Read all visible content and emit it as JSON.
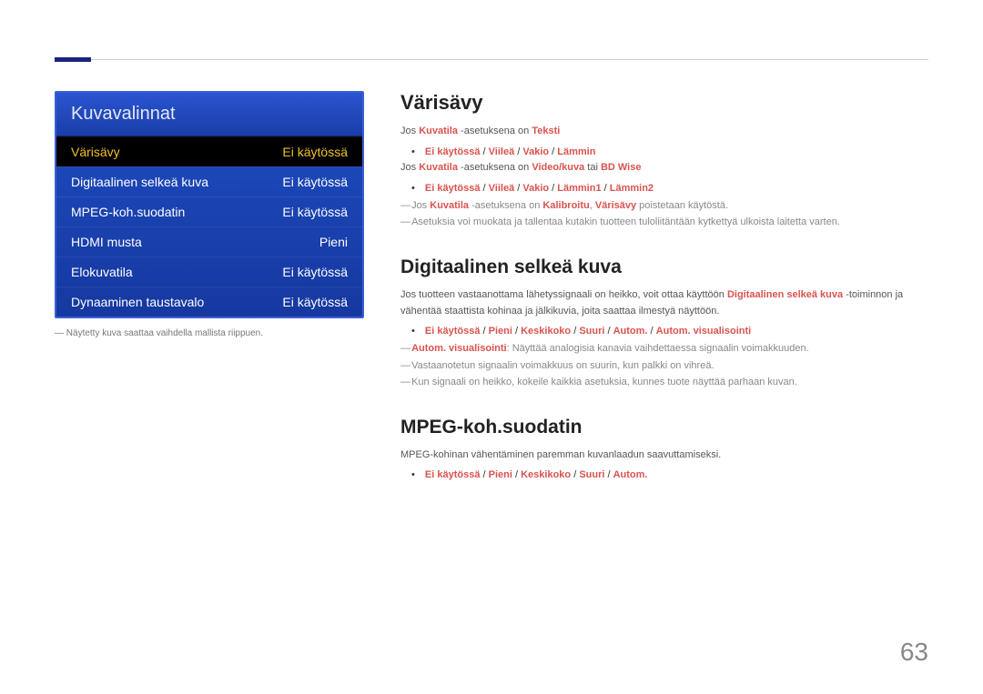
{
  "menu": {
    "title": "Kuvavalinnat",
    "rows": [
      {
        "label": "Värisävy",
        "value": "Ei käytössä",
        "highlight": true
      },
      {
        "label": "Digitaalinen selkeä kuva",
        "value": "Ei käytössä",
        "highlight": false
      },
      {
        "label": "MPEG-koh.suodatin",
        "value": "Ei käytössä",
        "highlight": false
      },
      {
        "label": "HDMI musta",
        "value": "Pieni",
        "highlight": false
      },
      {
        "label": "Elokuvatila",
        "value": "Ei käytössä",
        "highlight": false
      },
      {
        "label": "Dynaaminen taustavalo",
        "value": "Ei käytössä",
        "highlight": false
      }
    ],
    "caption_prefix": "―  ",
    "caption": "Näytetty kuva saattaa vaihdella mallista riippuen."
  },
  "s1": {
    "heading": "Värisävy",
    "line1_a": "Jos ",
    "line1_b": "Kuvatila",
    "line1_c": " -asetuksena on ",
    "line1_d": "Teksti",
    "bullet1_a": "Ei käytössä",
    "bullet1_b": "Viileä",
    "bullet1_c": "Vakio",
    "bullet1_d": "Lämmin",
    "line2_a": "Jos ",
    "line2_b": "Kuvatila",
    "line2_c": " -asetuksena on ",
    "line2_d": "Video/kuva",
    "line2_e": " tai ",
    "line2_f": "BD Wise",
    "bullet2_a": "Ei käytössä",
    "bullet2_b": "Viileä",
    "bullet2_c": "Vakio",
    "bullet2_d": "Lämmin1",
    "bullet2_e": "Lämmin2",
    "dash1_a": "Jos ",
    "dash1_b": "Kuvatila",
    "dash1_c": " -asetuksena on ",
    "dash1_d": "Kalibroitu",
    "dash1_e": ", ",
    "dash1_f": "Värisävy",
    "dash1_g": " poistetaan käytöstä.",
    "dash2": "Asetuksia voi muokata ja tallentaa kutakin tuotteen tuloliitäntään kytkettyä ulkoista laitetta varten."
  },
  "s2": {
    "heading": "Digitaalinen selkeä kuva",
    "para_a": "Jos tuotteen vastaanottama lähetyssignaali on heikko, voit ottaa käyttöön ",
    "para_b": "Digitaalinen selkeä kuva",
    "para_c": " -toiminnon ja vähentää staattista kohinaa ja jälkikuvia, joita saattaa ilmestyä näyttöön.",
    "bullet_a": "Ei käytössä",
    "bullet_b": "Pieni",
    "bullet_c": "Keskikoko",
    "bullet_d": "Suuri",
    "bullet_e": "Autom.",
    "bullet_f": "Autom. visualisointi",
    "dash1_a": "Autom. visualisointi",
    "dash1_b": ": Näyttää analogisia kanavia vaihdettaessa signaalin voimakkuuden.",
    "dash2": "Vastaanotetun signaalin voimakkuus on suurin, kun palkki on vihreä.",
    "dash3": "Kun signaali on heikko, kokeile kaikkia asetuksia, kunnes tuote näyttää parhaan kuvan."
  },
  "s3": {
    "heading": "MPEG-koh.suodatin",
    "para": "MPEG-kohinan vähentäminen paremman kuvanlaadun saavuttamiseksi.",
    "bullet_a": "Ei käytössä",
    "bullet_b": "Pieni",
    "bullet_c": "Keskikoko",
    "bullet_d": "Suuri",
    "bullet_e": "Autom."
  },
  "slash": " / ",
  "page_number": "63"
}
